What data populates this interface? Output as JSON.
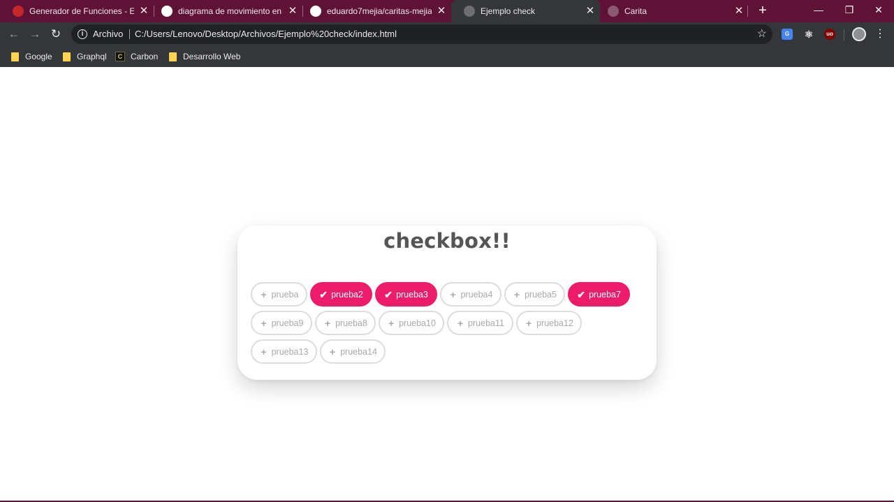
{
  "browser": {
    "tabs": [
      {
        "title": "Generador de Funciones - Ecu",
        "close": "✕"
      },
      {
        "title": "diagrama de movimiento en la",
        "close": "✕"
      },
      {
        "title": "eduardo7mejia/caritas-mejia: C",
        "close": "✕"
      },
      {
        "title": "Ejemplo check",
        "close": "✕"
      },
      {
        "title": "Carita",
        "close": "✕"
      }
    ],
    "new_tab": "+",
    "window_controls": {
      "minimize": "—",
      "restore": "❐",
      "close": "✕"
    },
    "nav": {
      "back": "←",
      "forward": "→",
      "reload": "↻"
    },
    "address": {
      "scheme_label": "Archivo",
      "url": "C:/Users/Lenovo/Desktop/Archivos/Ejemplo%20check/index.html",
      "info": "i",
      "star": "☆"
    },
    "menu": "⋮",
    "bookmarks": [
      "Google",
      "Graphql",
      "Carbon",
      "Desarrollo Web"
    ]
  },
  "page": {
    "title": "checkbox!!",
    "accent_color": "#ec1c6b",
    "unchecked_icon": "+",
    "checked_icon": "✔",
    "options": [
      {
        "label": "prueba",
        "checked": false
      },
      {
        "label": "prueba2",
        "checked": true
      },
      {
        "label": "prueba3",
        "checked": true
      },
      {
        "label": "prueba4",
        "checked": false
      },
      {
        "label": "prueba5",
        "checked": false
      },
      {
        "label": "prueba7",
        "checked": true
      },
      {
        "label": "prueba9",
        "checked": false
      },
      {
        "label": "prueba8",
        "checked": false
      },
      {
        "label": "prueba10",
        "checked": false
      },
      {
        "label": "prueba11",
        "checked": false
      },
      {
        "label": "prueba12",
        "checked": false
      },
      {
        "label": "prueba13",
        "checked": false
      },
      {
        "label": "prueba14",
        "checked": false
      }
    ]
  }
}
